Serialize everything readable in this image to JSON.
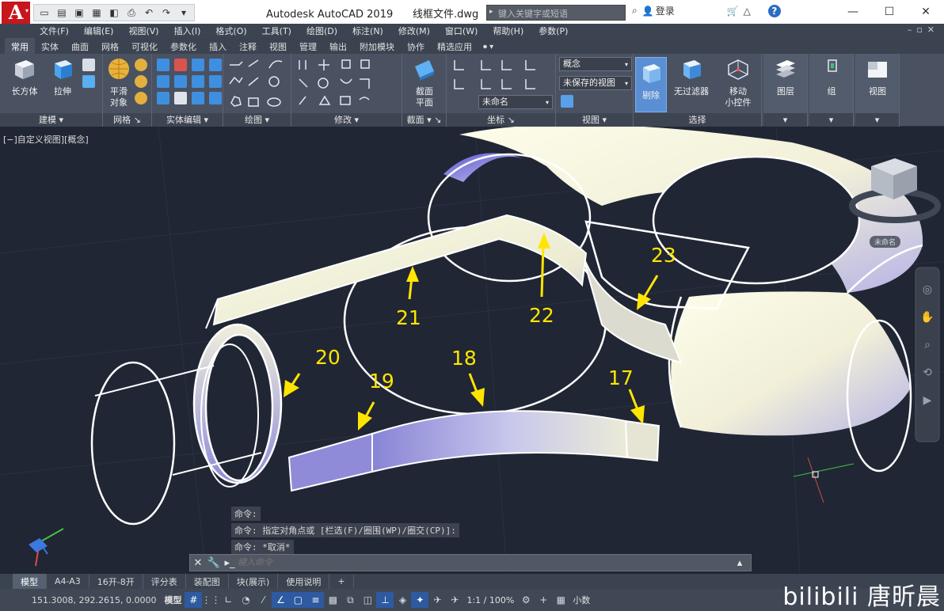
{
  "titlebar": {
    "app_letter": "A",
    "title": "Autodesk AutoCAD 2019      线框文件.dwg",
    "search_placeholder": "键入关键字或短语",
    "login": "登录",
    "help": "?"
  },
  "menu": [
    "文件(F)",
    "编辑(E)",
    "视图(V)",
    "插入(I)",
    "格式(O)",
    "工具(T)",
    "绘图(D)",
    "标注(N)",
    "修改(M)",
    "窗口(W)",
    "帮助(H)",
    "参数(P)"
  ],
  "ribbon_tabs": [
    "常用",
    "实体",
    "曲面",
    "网格",
    "可视化",
    "参数化",
    "插入",
    "注释",
    "视图",
    "管理",
    "输出",
    "附加模块",
    "协作",
    "精选应用"
  ],
  "ribbon": {
    "box": "长方体",
    "extrude": "拉伸",
    "smooth": "平滑\n对象",
    "section_plane": "截面\n平面",
    "cull": "剔除",
    "no_filter": "无过滤器",
    "move_gizmo": "移动\n小控件",
    "layers": "图层",
    "groups": "组",
    "view": "视图",
    "visual_style": "概念",
    "unsaved_view": "未保存的视图",
    "unnamed": "未命名",
    "panels": [
      "建模",
      "网格",
      "实体编辑",
      "绘图",
      "修改",
      "截面",
      "坐标",
      "视图",
      "选择"
    ]
  },
  "viewport": {
    "label": "[−]自定义视图][概念]",
    "callouts": [
      "17",
      "18",
      "19",
      "20",
      "21",
      "22",
      "23"
    ],
    "viewcube_label": "未命名"
  },
  "command": {
    "history": [
      "命令:",
      "命令: 指定对角点或 [栏选(F)/圈围(WP)/圈交(CP)]:",
      "命令: *取消*"
    ],
    "placeholder": "键入命令"
  },
  "layout_tabs": [
    "模型",
    "A4-A3",
    "16开-8开",
    "评分表",
    "装配图",
    "块(展示)",
    "使用说明"
  ],
  "status": {
    "coords": "151.3008, 292.2615, 0.0000",
    "model": "模型",
    "scale": "1:1 / 100%",
    "units": "小数"
  },
  "watermark": "bilibili 唐昕晨"
}
